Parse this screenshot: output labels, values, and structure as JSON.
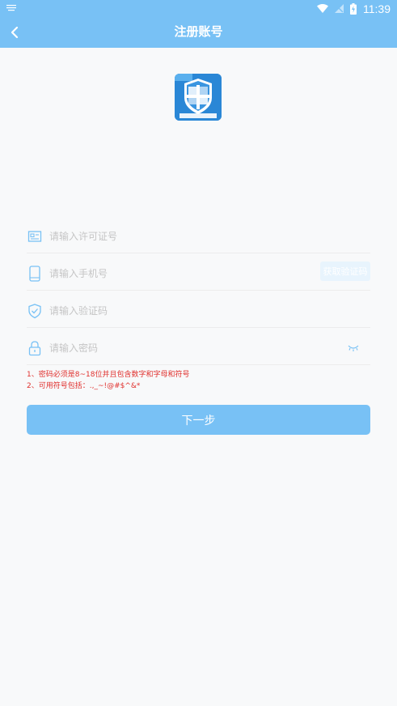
{
  "status_bar": {
    "time": "11:39"
  },
  "header": {
    "title": "注册账号"
  },
  "form": {
    "license_placeholder": "请输入许可证号",
    "phone_placeholder": "请输入手机号",
    "get_code_label": "获取验证码",
    "code_placeholder": "请输入验证码",
    "password_placeholder": "请输入密码"
  },
  "notes": {
    "line1": "1、密码必须是8~18位并且包含数字和字母和符号",
    "line2": "2、可用符号包括：.,_~!@#$^&*"
  },
  "next_button": {
    "label": "下一步"
  },
  "colors": {
    "accent": "#78c1f5",
    "warning": "#e0312e",
    "icon": "#78c1f5"
  }
}
